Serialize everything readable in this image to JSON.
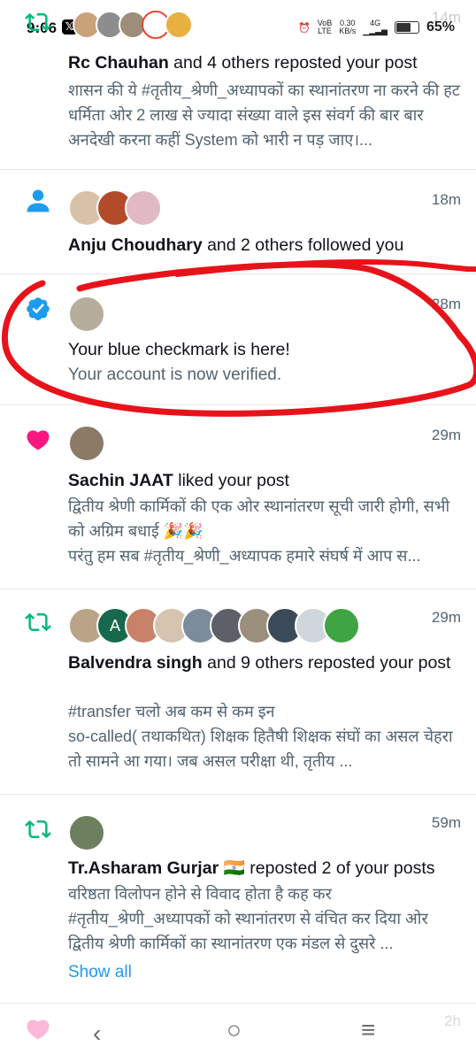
{
  "status_bar": {
    "time": "9:06",
    "x_badge": "𝕏",
    "network_top": "VoB",
    "network_bottom": "LTE",
    "speed_top": "0.30",
    "speed_bottom": "KB/s",
    "signal_label": "4G",
    "battery_pct": "65%",
    "battery_level": 0.65,
    "faded_time": "14m"
  },
  "notifications": [
    {
      "icon": "repost-icon",
      "icon_color": "#00ba7c",
      "name": "Rc Chauhan",
      "action": " and 4 others reposted your post",
      "body": "शासन की ये #तृतीय_श्रेणी_अध्यापकों का स्थानांतरण ना करने की हट धर्मिता ओर 2 लाख से ज्यादा संख्या वाले इस संवर्ग की बार बार अनदेखी करना कहीं System को भारी न पड़ जाए।..."
    },
    {
      "icon": "person-icon",
      "icon_color": "#1d9bf0",
      "time": "18m",
      "name": "Anju Choudhary",
      "action": " and 2 others followed you"
    },
    {
      "icon": "verified-badge-icon",
      "icon_color": "#1d9bf0",
      "time": "28m",
      "headline": "Your blue checkmark is here!",
      "body": "Your account is now verified."
    },
    {
      "icon": "heart-icon",
      "icon_color": "#f91880",
      "time": "29m",
      "name": "Sachin JAAT",
      "action": " liked your post",
      "body": "द्वितीय श्रेणी कार्मिकों की एक ओर स्थानांतरण सूची जारी होगी, सभी को अग्रिम बधाई 🎉🎉\nपरंतु हम सब #तृतीय_श्रेणी_अध्यापक हमारे संघर्ष में आप स..."
    },
    {
      "icon": "repost-icon",
      "icon_color": "#00ba7c",
      "time": "29m",
      "name": "Balvendra singh",
      "action": " and 9 others reposted your post",
      "avatar_letter": "A",
      "body": "#transfer      चलो अब कम से कम  इन\nso-called( तथाकथित) शिक्षक हितैषी शिक्षक संघों का असल चेहरा तो सामने आ गया। जब असल परीक्षा थी, तृतीय ..."
    },
    {
      "icon": "repost-icon",
      "icon_color": "#00ba7c",
      "time": "59m",
      "name": "Tr.Asharam Gurjar 🇮🇳",
      "action": " reposted 2 of your posts",
      "body": "वरिष्ठता विलोपन होने से विवाद होता है कह कर #तृतीय_श्रेणी_अध्यापकों को स्थानांतरण से वंचित कर दिया ओर द्वितीय श्रेणी कार्मिकों का स्थानांतरण एक मंडल से दुसरे ...",
      "show_all": "Show all"
    }
  ],
  "bottom": {
    "faded_time": "2h"
  },
  "colors": {
    "accent": "#1d9bf0",
    "text_secondary": "#536471",
    "annotation": "#e8131a"
  }
}
